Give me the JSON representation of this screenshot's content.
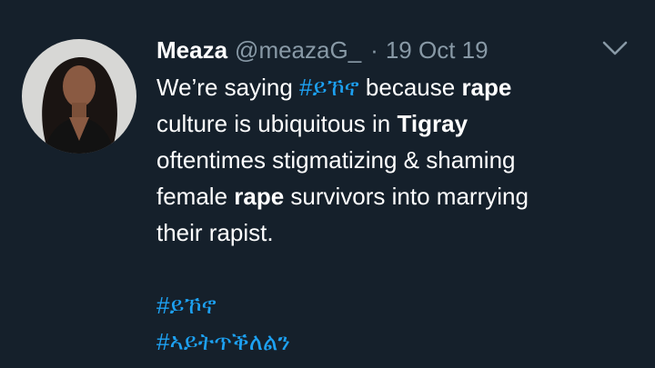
{
  "tweet": {
    "display_name": "Meaza",
    "handle": "@meazaG_",
    "separator": "·",
    "date": "19 Oct 19",
    "text": {
      "l1_a": "We’re saying ",
      "l1_hashtag": "#ይኾኖ",
      "l1_b": " because ",
      "l1_bold": "rape",
      "l2_a": "culture is ubiquitous in ",
      "l2_bold": "Tigray",
      "l3": "oftentimes stigmatizing & shaming",
      "l4_a": "female ",
      "l4_bold": "rape",
      "l4_b": " survivors into marrying",
      "l5": "their rapist."
    },
    "hashtags": [
      "#ይኾኖ",
      "#ኣይትጥቕለልን"
    ]
  },
  "colors": {
    "background": "#15202b",
    "text": "#ffffff",
    "muted": "#8899a6",
    "link": "#1da1f2"
  },
  "icons": {
    "menu": "chevron-down-icon"
  }
}
